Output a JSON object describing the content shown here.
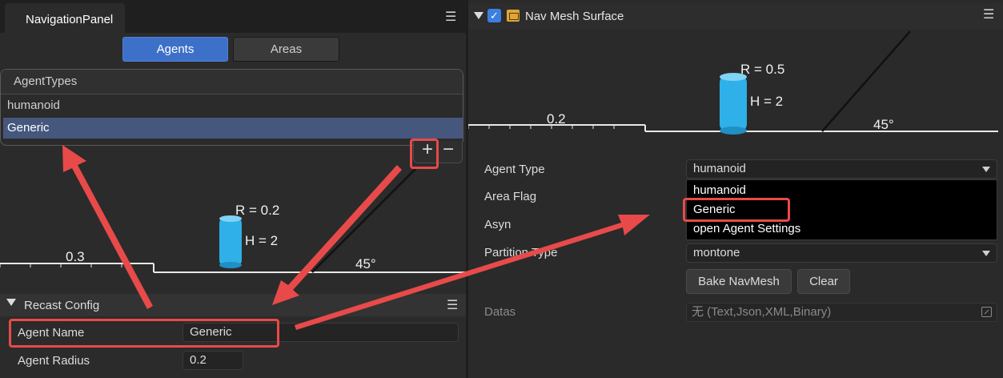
{
  "left_panel": {
    "tab_title": "NavigationPanel",
    "segments": {
      "agents": "Agents",
      "areas": "Areas"
    },
    "agent_types": {
      "header": "AgentTypes",
      "items": [
        "humanoid",
        "Generic"
      ],
      "selected": "Generic",
      "add_symbol": "+",
      "remove_symbol": "−"
    },
    "diagram": {
      "radius_label": "R = 0.2",
      "height_label": "H = 2",
      "step_label": "0.3",
      "slope_label": "45°"
    },
    "recast_config": {
      "title": "Recast Config",
      "agent_name_label": "Agent Name",
      "agent_name_value": "Generic",
      "agent_radius_label": "Agent Radius",
      "agent_radius_value": "0.2"
    }
  },
  "right_panel": {
    "component_title": "Nav Mesh Surface",
    "enabled": true,
    "diagram": {
      "radius_label": "R = 0.5",
      "height_label": "H = 2",
      "step_label": "0.2",
      "slope_label": "45°"
    },
    "properties": {
      "agent_type_label": "Agent Type",
      "agent_type_value": "humanoid",
      "area_flag_label": "Area Flag",
      "asyn_label": "Asyn",
      "partition_type_label": "Partition Type",
      "partition_type_value": "montone",
      "datas_label": "Datas",
      "datas_placeholder": "无 (Text,Json,XML,Binary)"
    },
    "dropdown_options": [
      "humanoid",
      "Generic",
      "open Agent Settings"
    ],
    "buttons": {
      "bake": "Bake NavMesh",
      "clear": "Clear"
    }
  },
  "icons": [
    "menu-icon",
    "collapse-arrow-icon",
    "checkbox-icon",
    "component-icon",
    "dropdown-caret-icon",
    "expand-icon",
    "capsule-icon"
  ],
  "colors": {
    "accent": "#3d70c8",
    "selection": "#46577e",
    "annotation": "#e84a4a",
    "capsule": "#2fb0e8"
  }
}
